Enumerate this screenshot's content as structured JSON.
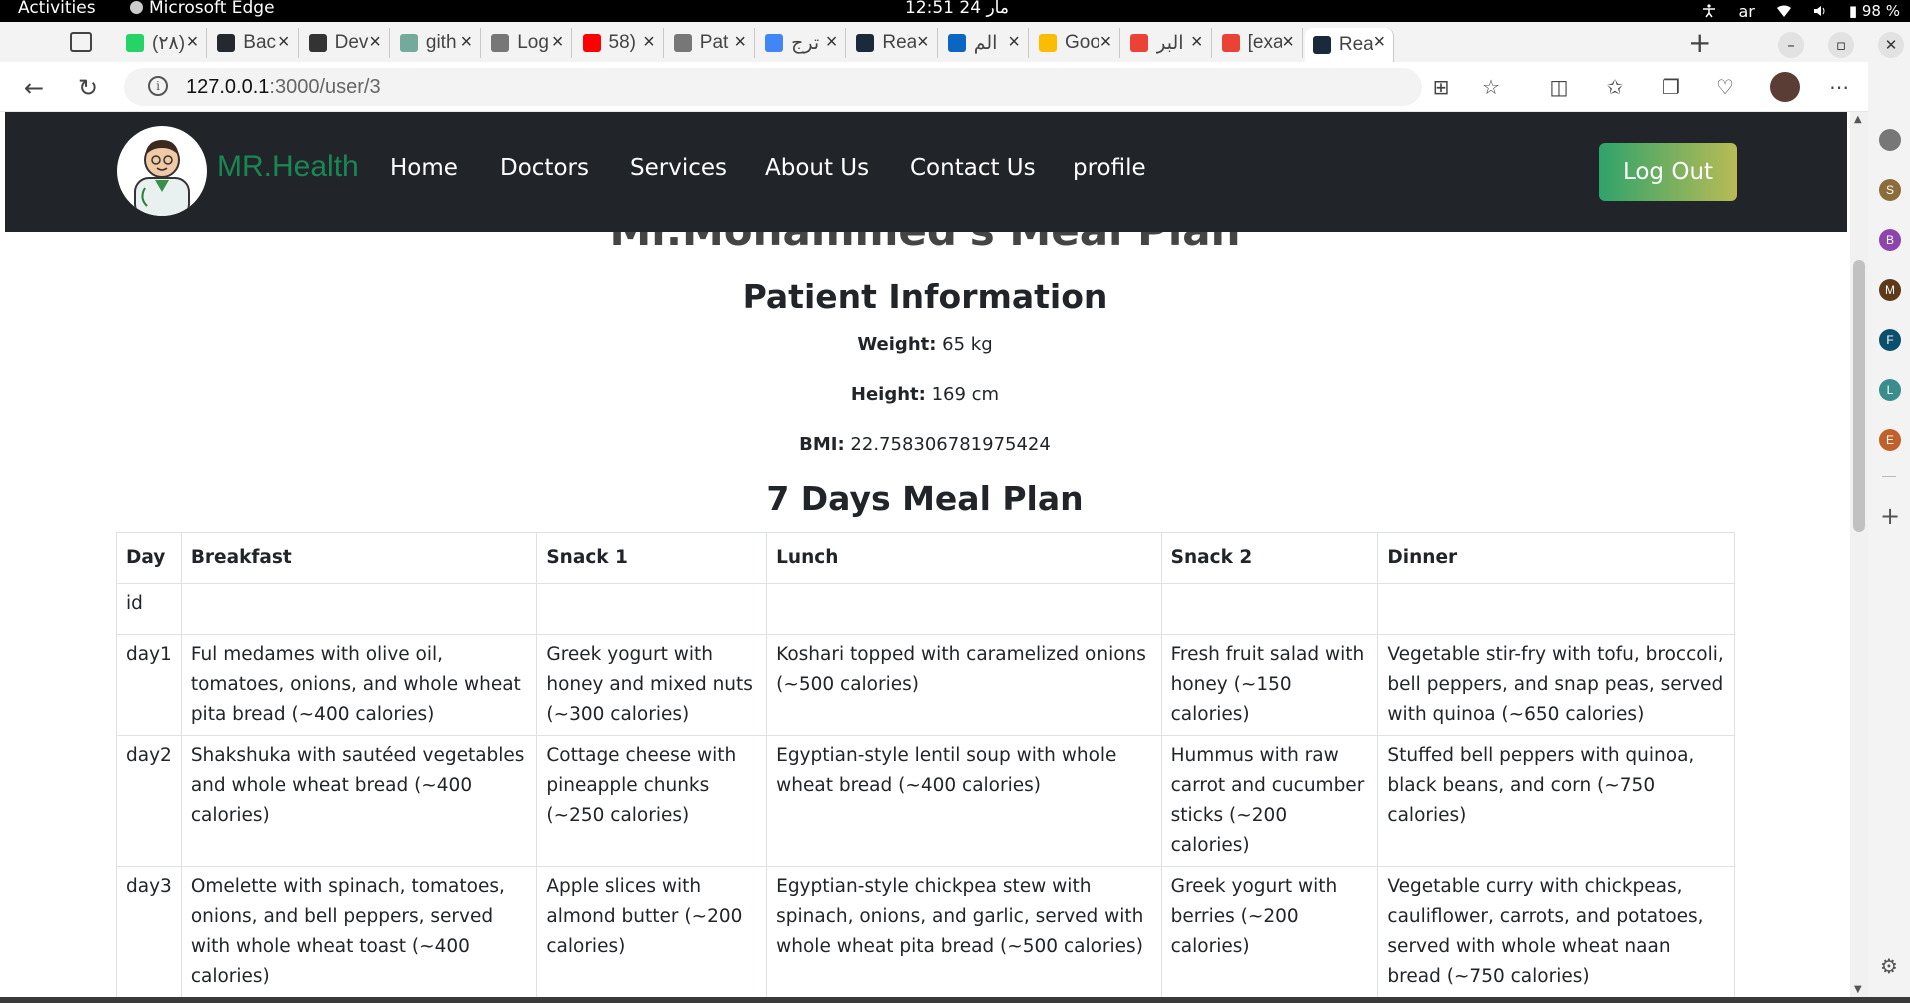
{
  "system_bar": {
    "activities": "Activities",
    "app_name": "Microsoft Edge",
    "clock": "12:51  24 مار",
    "lang": "ar",
    "battery": "98 %"
  },
  "tabs": [
    {
      "title": "(٢٨)",
      "fav_color": "#25d366"
    },
    {
      "title": "Bac",
      "fav_color": "#24292f"
    },
    {
      "title": "Dev",
      "fav_color": "#333333"
    },
    {
      "title": "gith",
      "fav_color": "#74aa9c"
    },
    {
      "title": "Log",
      "fav_color": "#777777"
    },
    {
      "title": "58)",
      "fav_color": "#ff0000"
    },
    {
      "title": "Pat",
      "fav_color": "#777777"
    },
    {
      "title": "ترج",
      "fav_color": "#4285f4"
    },
    {
      "title": "Rea",
      "fav_color": "#1b2a3a"
    },
    {
      "title": "الم",
      "fav_color": "#0a66c2"
    },
    {
      "title": "Goo",
      "fav_color": "#fbbc04"
    },
    {
      "title": "البر",
      "fav_color": "#ea4335"
    },
    {
      "title": "[exa",
      "fav_color": "#ea4335"
    },
    {
      "title": "Rea",
      "fav_color": "#1b2a3a"
    }
  ],
  "address": {
    "host": "127.0.0.1",
    "rest": ":3000/user/3"
  },
  "sidebar_letters": [
    "S",
    "B",
    "M",
    "F",
    "L",
    "E"
  ],
  "site": {
    "brand": "MR.Health",
    "nav": [
      "Home",
      "Doctors",
      "Services",
      "About Us",
      "Contact Us",
      "profile"
    ],
    "logout": "Log Out"
  },
  "page": {
    "cut_title": "Mr.Mohammed's Meal Plan",
    "patient_heading": "Patient Information",
    "weight_label": "Weight:",
    "weight_value": "65 kg",
    "height_label": "Height:",
    "height_value": "169 cm",
    "bmi_label": "BMI:",
    "bmi_value": "22.758306781975424",
    "meal_heading": "7 Days Meal Plan"
  },
  "table": {
    "headers": [
      "Day",
      "Breakfast",
      "Snack 1",
      "Lunch",
      "Snack 2",
      "Dinner"
    ],
    "rows": [
      [
        "id",
        "",
        "",
        "",
        "",
        ""
      ],
      [
        "day1",
        "Ful medames with olive oil, tomatoes, onions, and whole wheat pita bread (~400 calories)",
        "Greek yogurt with honey and mixed nuts (~300 calories)",
        "Koshari topped with caramelized onions (~500 calories)",
        "Fresh fruit salad with honey (~150 calories)",
        "Vegetable stir-fry with tofu, broccoli, bell peppers, and snap peas, served with quinoa (~650 calories)"
      ],
      [
        "day2",
        "Shakshuka with sautéed vegetables and whole wheat bread (~400 calories)",
        "Cottage cheese with pineapple chunks (~250 calories)",
        "Egyptian-style lentil soup with whole wheat bread (~400 calories)",
        "Hummus with raw carrot and cucumber sticks (~200 calories)",
        "Stuffed bell peppers with quinoa, black beans, and corn (~750 calories)"
      ],
      [
        "day3",
        "Omelette with spinach, tomatoes, onions, and bell peppers, served with whole wheat toast (~400 calories)",
        "Apple slices with almond butter (~200 calories)",
        "Egyptian-style chickpea stew with spinach, onions, and garlic, served with whole wheat pita bread (~500 calories)",
        "Greek yogurt with berries (~200 calories)",
        "Vegetable curry with chickpeas, cauliflower, carrots, and potatoes, served with whole wheat naan bread (~750 calories)"
      ]
    ]
  },
  "colors": {
    "navbar_bg": "#212529",
    "brand_green": "#198754",
    "logout_gradient_start": "#2fa36b",
    "logout_gradient_end": "#b9bb55"
  }
}
